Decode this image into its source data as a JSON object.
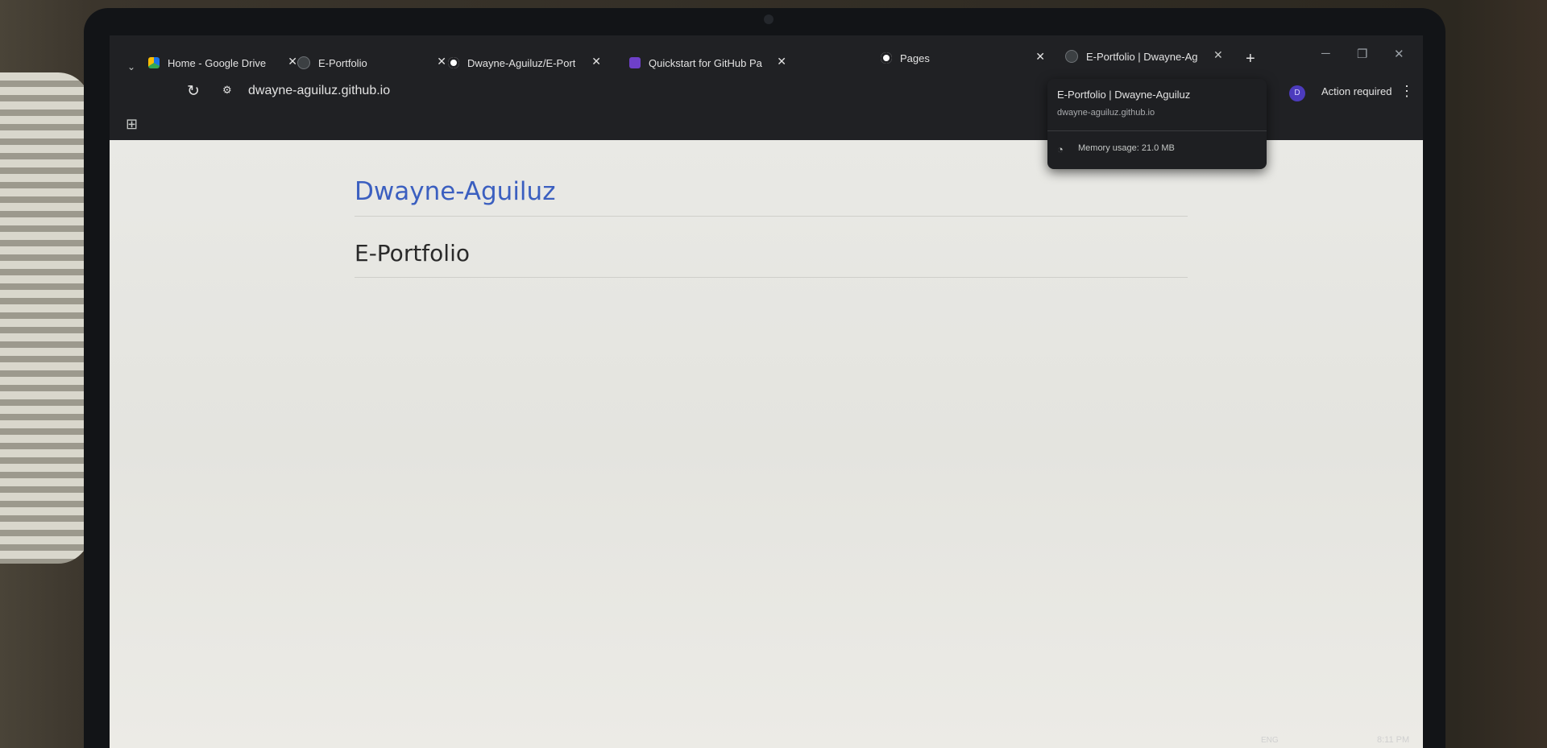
{
  "tabs": [
    {
      "title": "Home - Google Drive",
      "favicon": "google-drive-icon"
    },
    {
      "title": "E-Portfolio",
      "favicon": "globe-icon"
    },
    {
      "title": "Dwayne-Aguiluz/E-Port",
      "favicon": "github-icon"
    },
    {
      "title": "Quickstart for GitHub Pa",
      "favicon": "github-docs-icon"
    },
    {
      "title": "Pages",
      "favicon": "github-icon"
    },
    {
      "title": "E-Portfolio | Dwayne-Ag",
      "favicon": "globe-icon"
    }
  ],
  "toolbar": {
    "url": "dwayne-aguiluz.github.io"
  },
  "hovercard": {
    "title": "E-Portfolio | Dwayne-Aguiluz",
    "url": "dwayne-aguiluz.github.io",
    "memory": "Memory usage: 21.0 MB"
  },
  "profile": {
    "initial": "D",
    "action_label": "Action required"
  },
  "page": {
    "site_title": "Dwayne-Aguiluz",
    "heading": "E-Portfolio"
  },
  "taskbar": {
    "language": "ENG",
    "time": "8:11 PM"
  },
  "colors": {
    "link_blue": "#3b5fc0",
    "browser_chrome": "#202124",
    "page_background": "#e9e9e5"
  }
}
